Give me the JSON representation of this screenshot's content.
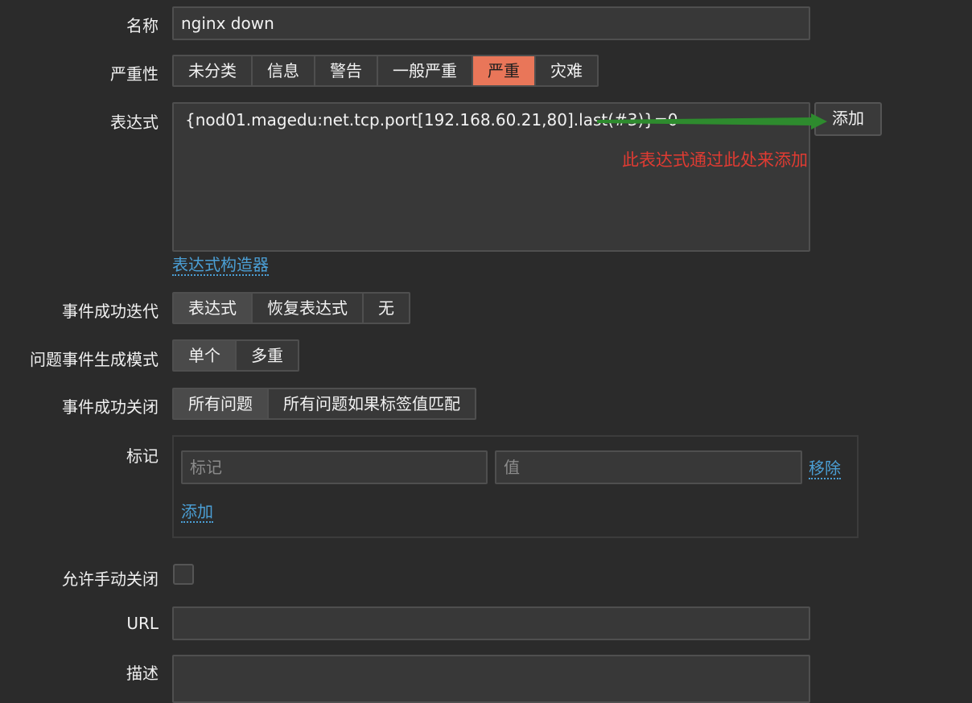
{
  "form": {
    "name": {
      "label": "名称",
      "value": "nginx down"
    },
    "severity": {
      "label": "严重性",
      "options": [
        "未分类",
        "信息",
        "警告",
        "一般严重",
        "严重",
        "灾难"
      ],
      "selected": "严重",
      "selected_color": "#e97659"
    },
    "expression": {
      "label": "表达式",
      "value": "{nod01.magedu:net.tcp.port[192.168.60.21,80].last(#3)}=0",
      "add_button": "添加",
      "builder_link": "表达式构造器"
    },
    "annotation": {
      "text": "此表达式通过此处来添加",
      "text_color": "#e03b32",
      "arrow_color": "#2e8b2e"
    },
    "recovery": {
      "label": "事件成功迭代",
      "options": [
        "表达式",
        "恢复表达式",
        "无"
      ],
      "selected": "表达式"
    },
    "problem_mode": {
      "label": "问题事件生成模式",
      "options": [
        "单个",
        "多重"
      ],
      "selected": "单个"
    },
    "ok_close": {
      "label": "事件成功关闭",
      "options": [
        "所有问题",
        "所有问题如果标签值匹配"
      ],
      "selected": "所有问题"
    },
    "tags": {
      "label": "标记",
      "tag_placeholder": "标记",
      "value_placeholder": "值",
      "remove_link": "移除",
      "add_link": "添加"
    },
    "manual_close": {
      "label": "允许手动关闭",
      "checked": false
    },
    "url": {
      "label": "URL",
      "value": ""
    },
    "description": {
      "label": "描述"
    }
  }
}
